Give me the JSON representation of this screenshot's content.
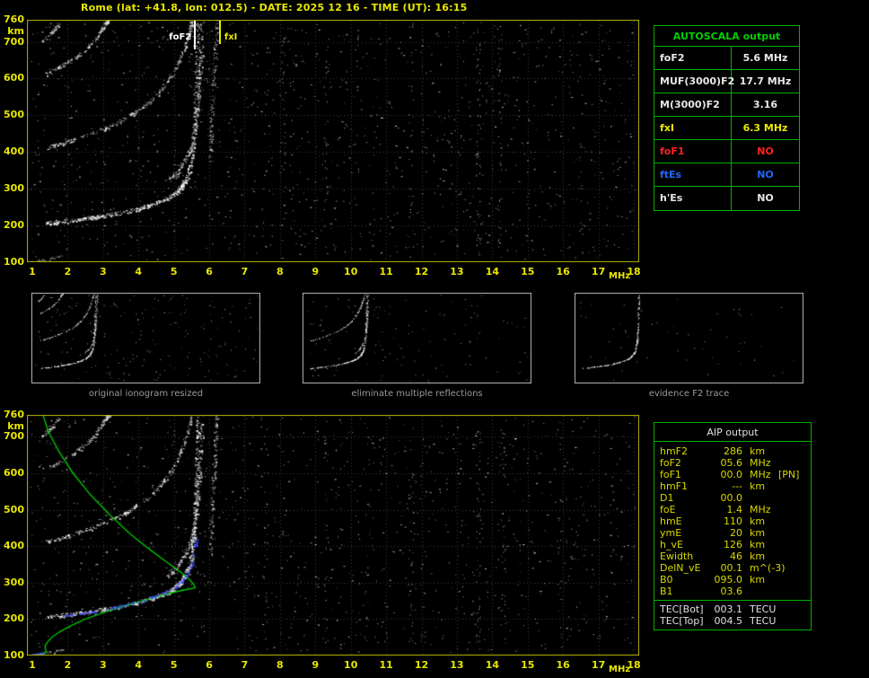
{
  "title": "Rome (lat: +41.8, lon: 012.5) - DATE: 2025 12 16 - TIME (UT): 16:15",
  "colors": {
    "background": "#000000",
    "axis_label": "#e8e800",
    "plot_border": "#b8b800",
    "grid": "#3a3a3a",
    "trace": "#ffffff",
    "table_border": "#00b000",
    "table_header_green": "#00d000",
    "panel_border": "#b0b0b0",
    "caption": "#9a9a9a",
    "profile_green": "#00c000",
    "fit_blue": "#3c50ff"
  },
  "axes": {
    "x_ticks": [
      1,
      2,
      3,
      4,
      5,
      6,
      7,
      8,
      9,
      10,
      11,
      12,
      13,
      14,
      15,
      16,
      17,
      18
    ],
    "x_unit": "MHz",
    "y_ticks": [
      760,
      700,
      600,
      500,
      400,
      300,
      200,
      100
    ],
    "y_unit": "km",
    "x_range": [
      1,
      18
    ],
    "y_range": [
      100,
      760
    ]
  },
  "traces": {
    "main": {
      "n": 600,
      "jf": 0.06,
      "jh": 5,
      "a": 1.0,
      "points": [
        [
          1.35,
          206
        ],
        [
          2.0,
          213
        ],
        [
          2.7,
          222
        ],
        [
          3.4,
          233
        ],
        [
          4.0,
          246
        ],
        [
          4.5,
          261
        ],
        [
          4.9,
          278
        ],
        [
          5.15,
          298
        ],
        [
          5.35,
          326
        ],
        [
          5.48,
          365
        ],
        [
          5.55,
          420
        ],
        [
          5.6,
          490
        ],
        [
          5.63,
          570
        ],
        [
          5.66,
          660
        ],
        [
          5.68,
          760
        ]
      ]
    },
    "cusp": {
      "n": 200,
      "jf": 0.05,
      "jh": 7,
      "a": 0.85,
      "points": [
        [
          4.8,
          318
        ],
        [
          5.1,
          346
        ],
        [
          5.35,
          383
        ],
        [
          5.52,
          428
        ],
        [
          5.63,
          488
        ],
        [
          5.7,
          556
        ],
        [
          5.76,
          640
        ],
        [
          5.8,
          760
        ]
      ]
    },
    "spread": {
      "n": 120,
      "jf": 0.05,
      "jh": 9,
      "a": 0.8,
      "points": [
        [
          6.02,
          380
        ],
        [
          6.06,
          460
        ],
        [
          6.1,
          555
        ],
        [
          6.15,
          655
        ],
        [
          6.2,
          760
        ]
      ]
    },
    "hop2": {
      "n": 280,
      "jf": 0.05,
      "jh": 5,
      "a": 0.9,
      "points": [
        [
          1.4,
          412
        ],
        [
          2.0,
          428
        ],
        [
          2.7,
          452
        ],
        [
          3.4,
          480
        ],
        [
          4.0,
          514
        ],
        [
          4.5,
          554
        ],
        [
          4.9,
          602
        ],
        [
          5.2,
          658
        ],
        [
          5.4,
          715
        ],
        [
          5.5,
          760
        ]
      ]
    },
    "hop3": {
      "n": 150,
      "jf": 0.05,
      "jh": 5,
      "a": 0.85,
      "points": [
        [
          1.4,
          612
        ],
        [
          1.9,
          638
        ],
        [
          2.4,
          670
        ],
        [
          2.8,
          708
        ],
        [
          3.05,
          748
        ],
        [
          3.15,
          760
        ]
      ]
    },
    "hop4": {
      "n": 50,
      "jf": 0.04,
      "jh": 4,
      "a": 0.8,
      "points": [
        [
          1.25,
          700
        ],
        [
          1.55,
          726
        ],
        [
          1.75,
          752
        ]
      ]
    },
    "ebits": {
      "n": 35,
      "jf": 0.12,
      "jh": 3,
      "a": 0.7,
      "points": [
        [
          0.9,
          100
        ],
        [
          1.2,
          104
        ],
        [
          1.5,
          110
        ],
        [
          1.8,
          117
        ]
      ]
    }
  },
  "top_plot": {
    "use": [
      "main",
      "cusp",
      "spread",
      "hop2",
      "hop3",
      "hop4",
      "ebits"
    ],
    "noise": {
      "seed": 11,
      "count": 1250,
      "bands": [
        {
          "f": 8.1,
          "n": 30
        },
        {
          "f": 9.3,
          "n": 26
        },
        {
          "f": 11.7,
          "n": 34
        },
        {
          "f": 13.6,
          "n": 55
        },
        {
          "f": 14.2,
          "n": 40
        },
        {
          "f": 16.5,
          "n": 20
        }
      ]
    },
    "markers": [
      {
        "label": "foF2",
        "freq": 5.6,
        "color": "#ffffff",
        "side": "left",
        "line_height": 32
      },
      {
        "label": "fxI",
        "freq": 6.3,
        "color": "#e8e800",
        "side": "right",
        "line_height": 26
      }
    ]
  },
  "bottom_plot": {
    "use": [
      "main",
      "cusp",
      "spread",
      "hop2",
      "hop3",
      "hop4",
      "ebits"
    ],
    "noise": {
      "seed": 29,
      "count": 1150,
      "bands": [
        {
          "f": 7.6,
          "n": 26
        },
        {
          "f": 9.3,
          "n": 30
        },
        {
          "f": 11.7,
          "n": 28
        },
        {
          "f": 13.6,
          "n": 48
        },
        {
          "f": 14.3,
          "n": 36
        },
        {
          "f": 15.9,
          "n": 20
        }
      ]
    },
    "profile": {
      "color": "#00c000",
      "points": [
        [
          0.85,
          92
        ],
        [
          1.05,
          98
        ],
        [
          1.25,
          104
        ],
        [
          1.4,
          110
        ],
        [
          1.37,
          117
        ],
        [
          1.36,
          126
        ],
        [
          1.42,
          136
        ],
        [
          1.55,
          150
        ],
        [
          1.75,
          164
        ],
        [
          2.05,
          180
        ],
        [
          2.45,
          198
        ],
        [
          2.9,
          214
        ],
        [
          3.4,
          230
        ],
        [
          3.9,
          244
        ],
        [
          4.4,
          258
        ],
        [
          4.85,
          270
        ],
        [
          5.2,
          278
        ],
        [
          5.45,
          283
        ],
        [
          5.6,
          286
        ],
        [
          5.57,
          294
        ],
        [
          5.45,
          308
        ],
        [
          5.2,
          328
        ],
        [
          4.8,
          356
        ],
        [
          4.3,
          392
        ],
        [
          3.75,
          435
        ],
        [
          3.2,
          485
        ],
        [
          2.65,
          540
        ],
        [
          2.15,
          600
        ],
        [
          1.75,
          660
        ],
        [
          1.45,
          715
        ],
        [
          1.3,
          760
        ]
      ]
    },
    "fit": {
      "color": "#3c50ff",
      "n": 120,
      "points": [
        [
          1.9,
          210
        ],
        [
          2.4,
          217
        ],
        [
          2.9,
          225
        ],
        [
          3.4,
          235
        ],
        [
          3.9,
          247
        ],
        [
          4.3,
          259
        ],
        [
          4.7,
          273
        ],
        [
          5.0,
          288
        ],
        [
          5.25,
          306
        ],
        [
          5.42,
          330
        ],
        [
          5.53,
          360
        ],
        [
          5.6,
          395
        ],
        [
          5.63,
          430
        ]
      ]
    },
    "fit2": {
      "color": "#3c50ff",
      "n": 14,
      "points": [
        [
          0.92,
          100
        ],
        [
          1.15,
          105
        ],
        [
          1.35,
          112
        ]
      ]
    }
  },
  "panels": [
    {
      "caption": "original ionogram resized",
      "use": [
        "main",
        "cusp",
        "hop2",
        "hop3",
        "hop4"
      ],
      "noise": 200,
      "seed": 5
    },
    {
      "caption": "eliminate multiple reflections",
      "use": [
        "main",
        "cusp",
        "hop2"
      ],
      "noise": 120,
      "seed": 6
    },
    {
      "caption": "evidence F2 trace",
      "use": [
        "main"
      ],
      "noise": 55,
      "seed": 7
    }
  ],
  "autoscala_table": {
    "title": "AUTOSCALA output",
    "rows": [
      {
        "param": "foF2",
        "value": "5.6 MHz",
        "color": "#e8e8e8"
      },
      {
        "param": "MUF(3000)F2",
        "value": "17.7 MHz",
        "color": "#e8e8e8"
      },
      {
        "param": "M(3000)F2",
        "value": "3.16",
        "color": "#e8e8e8"
      },
      {
        "param": "fxI",
        "value": "6.3 MHz",
        "color": "#e8e800"
      },
      {
        "param": "foF1",
        "value": "NO",
        "color": "#ff2222"
      },
      {
        "param": "ftEs",
        "value": "NO",
        "color": "#2266ff"
      },
      {
        "param": "h'Es",
        "value": "NO",
        "color": "#e8e8e8"
      }
    ]
  },
  "aip_table": {
    "title": "AIP output",
    "rows": [
      {
        "param": "hmF2",
        "value": "286",
        "unit": "km",
        "extra": ""
      },
      {
        "param": "foF2",
        "value": "05.6",
        "unit": "MHz",
        "extra": ""
      },
      {
        "param": "foF1",
        "value": "00.0",
        "unit": "MHz",
        "extra": "[PN]"
      },
      {
        "param": "hmF1",
        "value": "---",
        "unit": "km",
        "extra": ""
      },
      {
        "param": "D1",
        "value": "00.0",
        "unit": "",
        "extra": ""
      },
      {
        "param": "foE",
        "value": "1.4",
        "unit": "MHz",
        "extra": ""
      },
      {
        "param": "hmE",
        "value": "110",
        "unit": "km",
        "extra": ""
      },
      {
        "param": "ymE",
        "value": "20",
        "unit": "km",
        "extra": ""
      },
      {
        "param": "h_vE",
        "value": "126",
        "unit": "km",
        "extra": ""
      },
      {
        "param": "Ewidth",
        "value": "46",
        "unit": "km",
        "extra": ""
      },
      {
        "param": "DelN_vE",
        "value": "00.1",
        "unit": "m^(-3)",
        "extra": ""
      },
      {
        "param": "B0",
        "value": "095.0",
        "unit": "km",
        "extra": ""
      },
      {
        "param": "B1",
        "value": "03.6",
        "unit": "",
        "extra": ""
      }
    ],
    "tec_rows": [
      {
        "param": "TEC[Bot]",
        "value": "003.1",
        "unit": "TECU",
        "extra": ""
      },
      {
        "param": "TEC[Top]",
        "value": "004.5",
        "unit": "TECU",
        "extra": ""
      }
    ]
  }
}
